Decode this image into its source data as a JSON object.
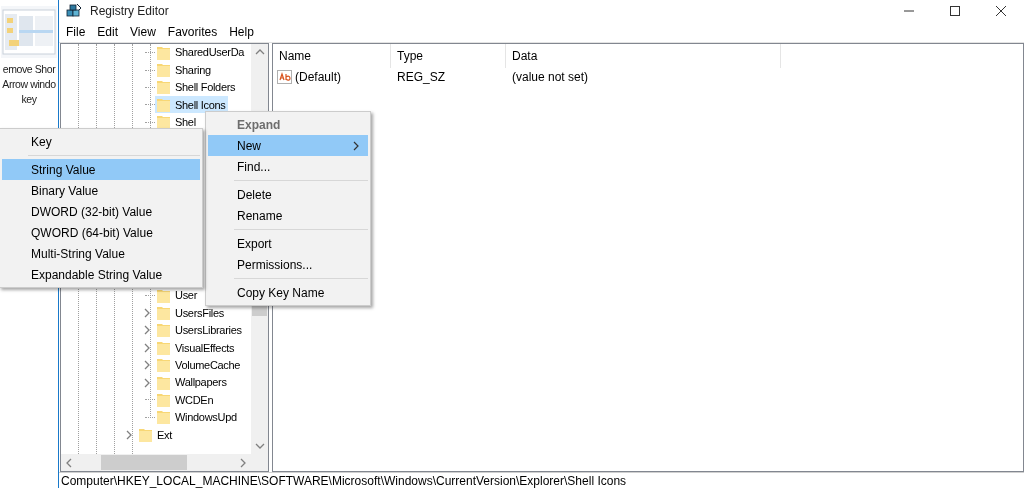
{
  "desktop": {
    "label_lines": [
      "emove Shor",
      "Arrow windo",
      "key"
    ]
  },
  "window": {
    "title": "Registry Editor"
  },
  "menu_bar": [
    "File",
    "Edit",
    "View",
    "Favorites",
    "Help"
  ],
  "tree": [
    {
      "children": [
        {
          "label": "SharedUserDa",
          "expandable": false,
          "selected": false
        },
        {
          "label": "Sharing",
          "expandable": false,
          "selected": false
        },
        {
          "label": "Shell Folders",
          "expandable": false,
          "selected": false
        },
        {
          "label": "Shell Icons",
          "expandable": false,
          "selected": true
        },
        {
          "label": "Shel",
          "expandable": false,
          "selected": false
        },
        {
          "label": "User",
          "expandable": false,
          "selected": false
        },
        {
          "label": "UsersFiles",
          "expandable": true,
          "selected": false
        },
        {
          "label": "UsersLibraries",
          "expandable": true,
          "selected": false
        },
        {
          "label": "VisualEffects",
          "expandable": true,
          "selected": false
        },
        {
          "label": "VolumeCache",
          "expandable": true,
          "selected": false
        },
        {
          "label": "Wallpapers",
          "expandable": true,
          "selected": false
        },
        {
          "label": "WCDEn",
          "expandable": false,
          "selected": false
        },
        {
          "label": "WindowsUpd",
          "expandable": false,
          "selected": false
        }
      ]
    },
    {
      "label": "Ext",
      "expandable": true,
      "selected": false
    }
  ],
  "values": {
    "columns": [
      "Name",
      "Type",
      "Data"
    ],
    "rows": [
      {
        "name": "(Default)",
        "type": "REG_SZ",
        "data": "(value not set)"
      }
    ]
  },
  "context_menu": {
    "items": [
      {
        "kind": "item",
        "label": "Expand",
        "bold": true,
        "disabled": true,
        "selected": false,
        "has_submenu": false
      },
      {
        "kind": "item",
        "label": "New",
        "bold": false,
        "disabled": false,
        "selected": true,
        "has_submenu": true
      },
      {
        "kind": "item",
        "label": "Find...",
        "bold": false,
        "disabled": false,
        "selected": false,
        "has_submenu": false
      },
      {
        "kind": "separator"
      },
      {
        "kind": "item",
        "label": "Delete",
        "bold": false,
        "disabled": false,
        "selected": false,
        "has_submenu": false
      },
      {
        "kind": "item",
        "label": "Rename",
        "bold": false,
        "disabled": false,
        "selected": false,
        "has_submenu": false
      },
      {
        "kind": "separator"
      },
      {
        "kind": "item",
        "label": "Export",
        "bold": false,
        "disabled": false,
        "selected": false,
        "has_submenu": false
      },
      {
        "kind": "item",
        "label": "Permissions...",
        "bold": false,
        "disabled": false,
        "selected": false,
        "has_submenu": false
      },
      {
        "kind": "separator"
      },
      {
        "kind": "item",
        "label": "Copy Key Name",
        "bold": false,
        "disabled": false,
        "selected": false,
        "has_submenu": false
      }
    ]
  },
  "submenu": {
    "items": [
      {
        "kind": "item",
        "label": "Key",
        "bold": false,
        "disabled": false,
        "selected": false,
        "has_submenu": false
      },
      {
        "kind": "separator"
      },
      {
        "kind": "item",
        "label": "String Value",
        "bold": false,
        "disabled": false,
        "selected": true,
        "has_submenu": false
      },
      {
        "kind": "item",
        "label": "Binary Value",
        "bold": false,
        "disabled": false,
        "selected": false,
        "has_submenu": false
      },
      {
        "kind": "item",
        "label": "DWORD (32-bit) Value",
        "bold": false,
        "disabled": false,
        "selected": false,
        "has_submenu": false
      },
      {
        "kind": "item",
        "label": "QWORD (64-bit) Value",
        "bold": false,
        "disabled": false,
        "selected": false,
        "has_submenu": false
      },
      {
        "kind": "item",
        "label": "Multi-String Value",
        "bold": false,
        "disabled": false,
        "selected": false,
        "has_submenu": false
      },
      {
        "kind": "item",
        "label": "Expandable String Value",
        "bold": false,
        "disabled": false,
        "selected": false,
        "has_submenu": false
      }
    ]
  },
  "status_bar": "Computer\\HKEY_LOCAL_MACHINE\\SOFTWARE\\Microsoft\\Windows\\CurrentVersion\\Explorer\\Shell Icons"
}
